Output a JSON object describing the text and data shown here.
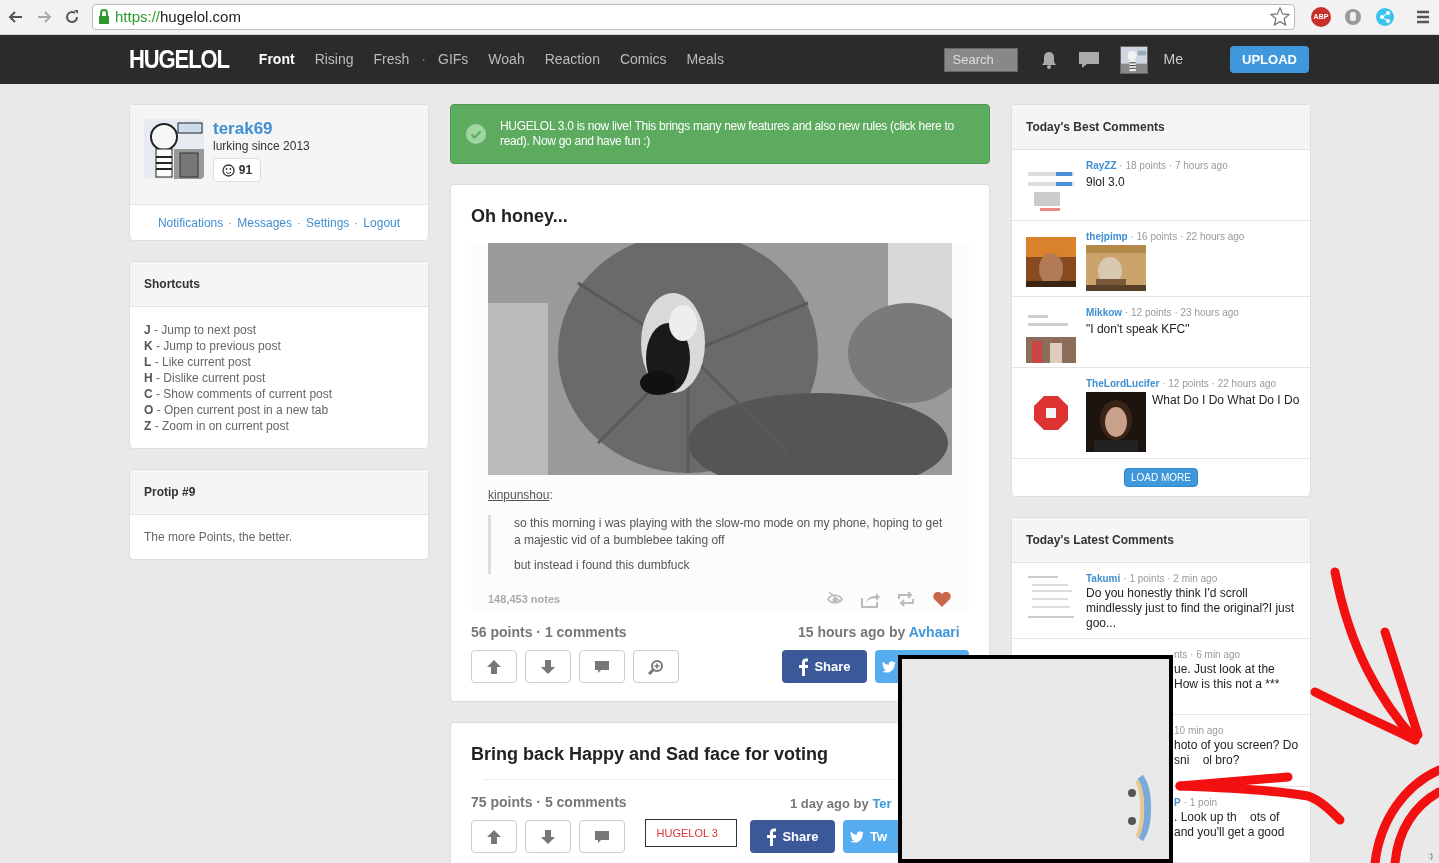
{
  "browser": {
    "url_scheme": "https://",
    "url_host": "hugelol.com",
    "abp_label": "ABP"
  },
  "nav": {
    "logo": "HUGELOL",
    "items": [
      {
        "kind": "link",
        "label": "Front",
        "selected": true
      },
      {
        "kind": "link",
        "label": "Rising",
        "selected": false
      },
      {
        "kind": "link",
        "label": "Fresh",
        "selected": false
      },
      {
        "kind": "separator",
        "label": "·"
      },
      {
        "kind": "link",
        "label": "GIFs",
        "selected": false
      },
      {
        "kind": "link",
        "label": "Woah",
        "selected": false
      },
      {
        "kind": "link",
        "label": "Reaction",
        "selected": false
      },
      {
        "kind": "link",
        "label": "Comics",
        "selected": false
      },
      {
        "kind": "link",
        "label": "Meals",
        "selected": false
      }
    ],
    "search_placeholder": "Search",
    "user_label": "Me",
    "upload": "UPLOAD"
  },
  "profile": {
    "username": "terak69",
    "since": "lurking since 2013",
    "points": "91",
    "links": [
      {
        "kind": "link",
        "label": "Notifications"
      },
      {
        "kind": "separator",
        "label": "·"
      },
      {
        "kind": "link",
        "label": "Messages"
      },
      {
        "kind": "separator",
        "label": "·"
      },
      {
        "kind": "link",
        "label": "Settings"
      },
      {
        "kind": "separator",
        "label": "·"
      },
      {
        "kind": "link",
        "label": "Logout"
      }
    ]
  },
  "shortcuts": {
    "title": "Shortcuts",
    "items": [
      {
        "key": "J",
        "text": "- Jump to next post"
      },
      {
        "key": "K",
        "text": "- Jump to previous post"
      },
      {
        "key": "L",
        "text": "- Like current post"
      },
      {
        "key": "H",
        "text": "- Dislike current post"
      },
      {
        "key": "C",
        "text": "- Show comments of current post"
      },
      {
        "key": "O",
        "text": "- Open current post in a new tab"
      },
      {
        "key": "Z",
        "text": "- Zoom in on current post"
      }
    ]
  },
  "protip": {
    "title": "Protip #9",
    "text": "The more Points, the better."
  },
  "notice": {
    "text": "HUGELOL 3.0 is now live! This brings many new features and also new rules (click here to read). Now go and have fun :)"
  },
  "posts": [
    {
      "title": "Oh honey...",
      "source": {
        "user": "kinpunshou",
        "colon": ":",
        "paragraphs": [
          "so this morning i was playing with the slow-mo mode on my phone, hoping to get a majestic vid of a bumblebee taking off",
          "but instead i found this dumbfuck"
        ],
        "notes": "148,453 notes",
        "liked": true
      },
      "stats": "56 points · 1 comments",
      "time": "15 hours ago by",
      "author": "Avhaari",
      "actions": [
        {
          "kind": "up"
        },
        {
          "kind": "down"
        },
        {
          "kind": "comment"
        },
        {
          "kind": "zoom"
        }
      ],
      "share": "Share"
    },
    {
      "title": "Bring back Happy and Sad face for voting",
      "stats": "75 points · 5 comments",
      "tag": "HUGELOL 3",
      "time": "1 day ago by",
      "author": "Ter",
      "actions": [
        {
          "kind": "up"
        },
        {
          "kind": "down"
        },
        {
          "kind": "comment"
        }
      ],
      "share": "Share",
      "tweet": "Tw"
    }
  ],
  "best_comments": {
    "title": "Today's Best Comments",
    "items": [
      {
        "kind": "text",
        "user": "RayZZ",
        "meta": "· 18 points · 7 hours ago",
        "text": "9lol 3.0"
      },
      {
        "user": "thejpimp",
        "meta": "· 16 points · 22 hours ago"
      },
      {
        "kind": "text",
        "user": "Mikkow",
        "meta": "· 12 points · 23 hours ago",
        "text": "\"I don't speak KFC\""
      },
      {
        "kind": "image_text",
        "user": "TheLordLucifer",
        "meta": "· 12 points · 22 hours ago",
        "text": "What Do I Do What Do I Do"
      }
    ],
    "load_more": "LOAD MORE"
  },
  "latest_comments": {
    "title": "Today's Latest Comments",
    "items": [
      {
        "user": "Takumi",
        "meta": "· 1 points · 2 min ago",
        "lines": [
          "Do you honestly think I'd scroll mindlessly just to find the original?I just goo..."
        ]
      },
      {
        "meta": "nts · 6 min ago",
        "lines": [
          "ue. Just look at the",
          "How is this not a ***"
        ]
      },
      {
        "meta": "10 min ago",
        "lines": [
          "hoto of you screen? Do",
          "sni    ol bro?"
        ]
      },
      {
        "user": "P",
        "meta": "· 1 poin",
        "lines": [
          ". Look up th    ots of",
          "and you'll get a good"
        ]
      }
    ]
  },
  "corner_text": ":)"
}
